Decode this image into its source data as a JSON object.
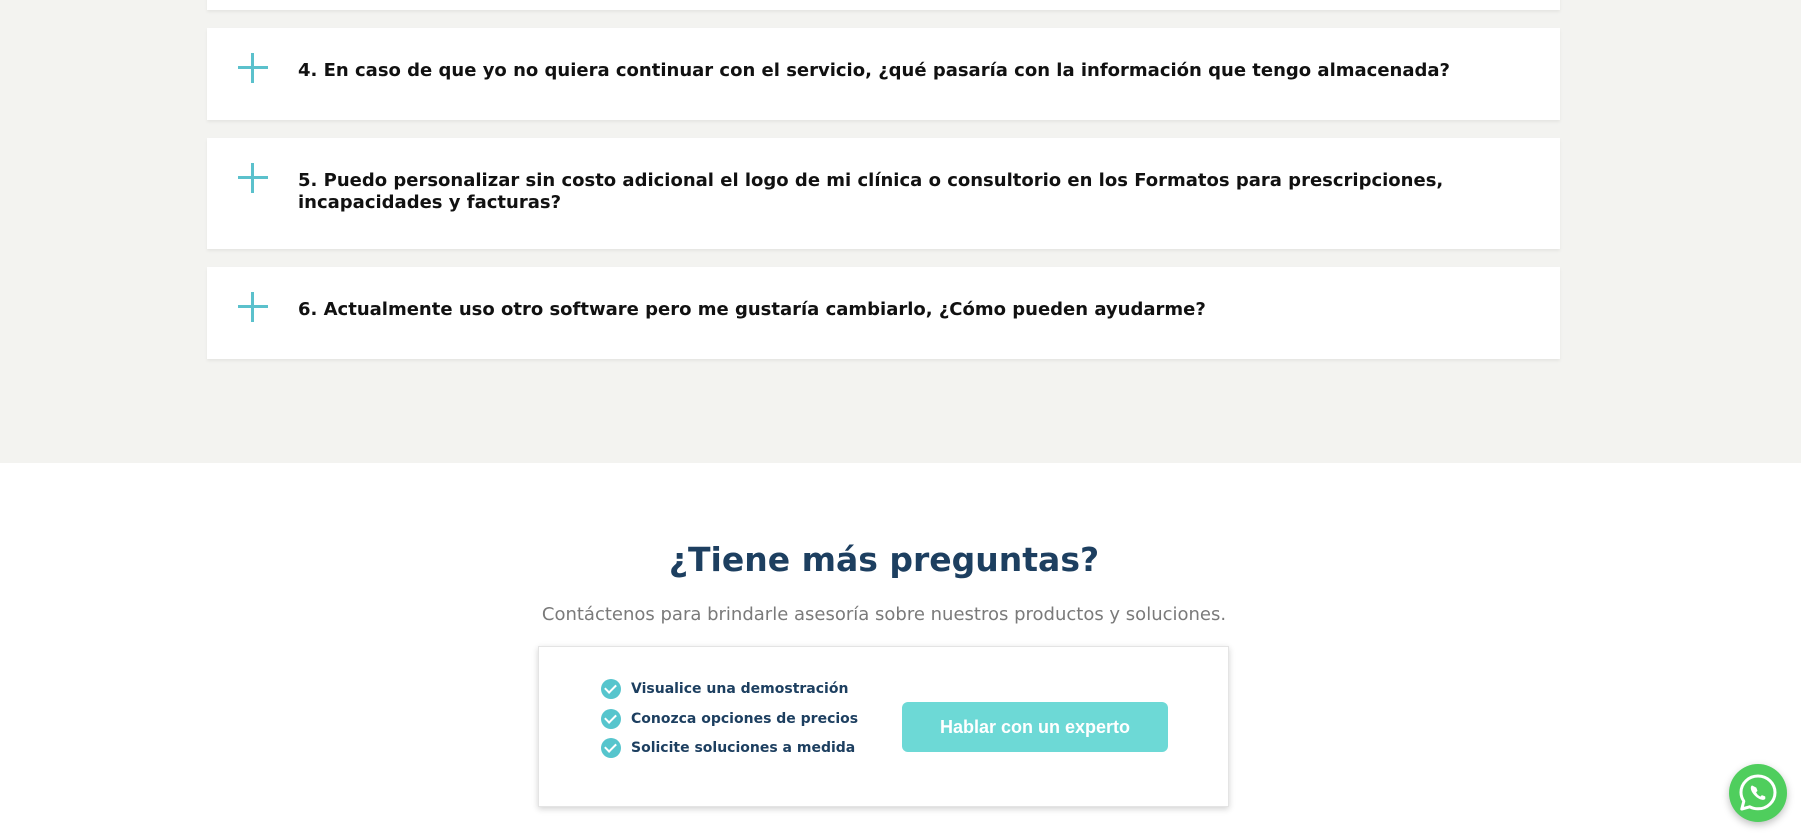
{
  "faq": {
    "items": [
      {
        "question": "4. En caso de que yo no quiera continuar con el servicio, ¿qué pasaría con la información que tengo almacenada?"
      },
      {
        "question": "5. Puedo personalizar sin costo adicional el logo de mi clínica o consultorio en los Formatos para prescripciones, incapacidades y facturas?"
      },
      {
        "question": "6. Actualmente uso otro software pero me gustaría cambiarlo, ¿Cómo pueden ayudarme?"
      }
    ]
  },
  "cta": {
    "title": "¿Tiene más preguntas?",
    "subtitle": "Contáctenos para brindarle asesoría sobre nuestros productos y soluciones.",
    "benefits": [
      {
        "label": "Visualice una demostración"
      },
      {
        "label": "Conozca opciones de precios"
      },
      {
        "label": "Solicite soluciones a medida"
      }
    ],
    "button_label": "Hablar con un experto"
  },
  "icons": {
    "expand": "plus-icon",
    "benefit": "check-circle-icon",
    "floating": "whatsapp-icon"
  },
  "colors": {
    "accent": "#5bc1cc",
    "button": "#6dd9d6",
    "heading": "#1d3f60",
    "section_bg": "#f3f3f0",
    "whatsapp": "#4fce5d"
  }
}
